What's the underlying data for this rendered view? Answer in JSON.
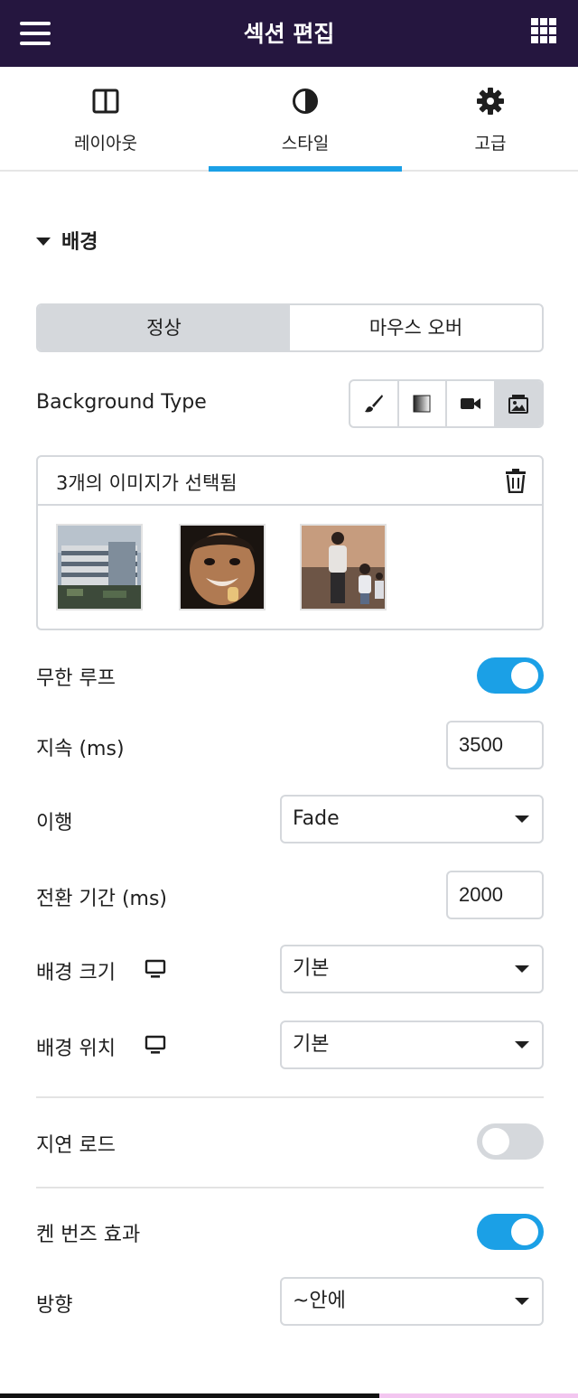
{
  "header": {
    "title": "섹션 편집",
    "menu_icon": "hamburger-menu-icon",
    "apps_icon": "grid-apps-icon"
  },
  "tabs": [
    {
      "label": "레이아웃",
      "icon": "columns-layout-icon",
      "active": false
    },
    {
      "label": "스타일",
      "icon": "half-circle-contrast-icon",
      "active": true
    },
    {
      "label": "고급",
      "icon": "gear-icon",
      "active": false
    }
  ],
  "section": {
    "title": "배경"
  },
  "state_tabs": {
    "normal": "정상",
    "hover": "마우스 오버",
    "active": "정상"
  },
  "background_type": {
    "label": "Background Type",
    "options": [
      "brush-icon",
      "gradient-icon",
      "video-camera-icon",
      "image-slideshow-icon"
    ],
    "selected": "image-slideshow-icon"
  },
  "gallery": {
    "summary": "3개의 이미지가 선택됨",
    "delete_icon": "trash-icon",
    "images": [
      "building-photo",
      "smiling-child-photo",
      "family-beach-photo"
    ]
  },
  "fields": {
    "infinite_loop": {
      "label": "무한 루프",
      "on": true
    },
    "duration": {
      "label": "지속 (ms)",
      "value": "3500"
    },
    "transition": {
      "label": "이행",
      "value": "Fade"
    },
    "transition_duration": {
      "label": "전환 기간 (ms)",
      "value": "2000"
    },
    "bg_size": {
      "label": "배경 크기",
      "value": "기본",
      "device_icon": "desktop-monitor-icon"
    },
    "bg_position": {
      "label": "배경 위치",
      "value": "기본",
      "device_icon": "desktop-monitor-icon"
    },
    "lazy_load": {
      "label": "지연 로드",
      "on": false
    },
    "ken_burns": {
      "label": "켄 번즈 효과",
      "on": true
    },
    "direction": {
      "label": "방향",
      "value": "~안에"
    }
  },
  "colors": {
    "header_bg": "#25163f",
    "accent": "#1ba0e6",
    "border": "#d5d8dc"
  }
}
